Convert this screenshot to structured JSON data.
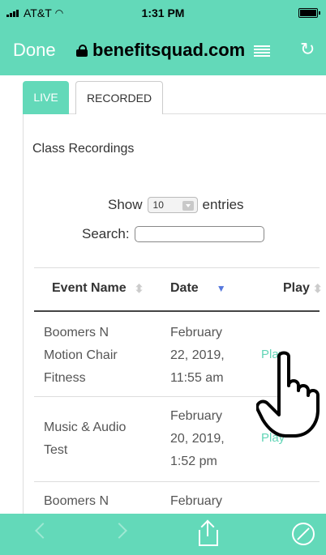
{
  "status_bar": {
    "carrier": "AT&T",
    "time": "1:31 PM"
  },
  "browser": {
    "done_label": "Done",
    "url": "benefitsquad.com"
  },
  "tabs": [
    {
      "label": "LIVE",
      "active": true
    },
    {
      "label": "RECORDED",
      "active": false
    }
  ],
  "section_title": "Class Recordings",
  "length": {
    "before": "Show",
    "value": "10",
    "after": "entries"
  },
  "search": {
    "label": "Search:",
    "value": ""
  },
  "table": {
    "headers": [
      "Event Name",
      "Date",
      "Play"
    ],
    "rows": [
      {
        "name": [
          "Boomers N",
          "Motion Chair",
          "Fitness"
        ],
        "date": [
          "February",
          "22, 2019,",
          "11:55 am"
        ],
        "play": "Play"
      },
      {
        "name": [
          "Music & Audio",
          "Test"
        ],
        "date": [
          "February",
          "20, 2019,",
          "1:52 pm"
        ],
        "play": "Play"
      },
      {
        "name": [
          "Boomers N"
        ],
        "date": [
          "February"
        ],
        "play": ""
      }
    ]
  },
  "colors": {
    "accent": "#63d9b9",
    "play_link": "#62d5b6"
  },
  "icons": [
    "lock-icon",
    "reader-icon",
    "reload-icon",
    "back-icon",
    "forward-icon",
    "share-icon",
    "compass-icon",
    "pointer-hand-icon"
  ]
}
